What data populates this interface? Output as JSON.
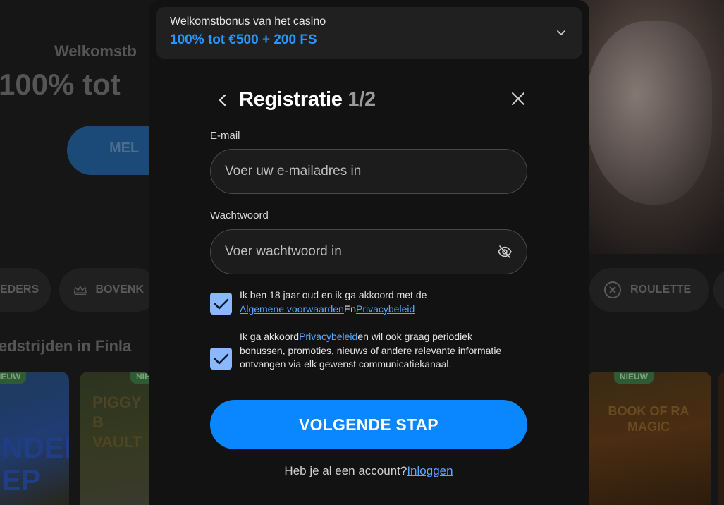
{
  "background": {
    "welcome_text": "Welkomstb",
    "headline": "100% tot",
    "cta_label": "MEL",
    "categories": [
      {
        "label": "EDERS"
      },
      {
        "label": "BOVENK"
      },
      {
        "label": "ROULETTE"
      }
    ],
    "section_title": "edstrijden in Finla",
    "card_badges": [
      "IEUW",
      "NIEU",
      "NIEUW"
    ],
    "card_titles": [
      "NDER EP",
      "PIGGY B VAULT",
      "BOOK OF RA MAGIC"
    ]
  },
  "bonus": {
    "label": "Welkomstbonus van het casino",
    "value": "100% tot €500 + 200 FS"
  },
  "modal": {
    "title": "Registratie",
    "step": "1/2",
    "email": {
      "label": "E-mail",
      "placeholder": "Voer uw e-mailadres in",
      "value": ""
    },
    "password": {
      "label": "Wachtwoord",
      "placeholder": "Voer wachtwoord in",
      "value": ""
    },
    "consent_terms": {
      "checked": true,
      "text_before": "Ik ben 18 jaar oud en ik ga akkoord met de",
      "link_terms": "Algemene voorwaarden",
      "joiner": "En",
      "link_privacy": "Privacybeleid"
    },
    "consent_marketing": {
      "checked": true,
      "text_before": "Ik ga akkoord",
      "link_privacy": "Privacybeleid",
      "text_after": "en wil ook graag periodiek bonussen, promoties, nieuws of andere relevante informatie ontvangen via elk gewenst communicatiekanaal."
    },
    "next_button": "VOLGENDE STAP",
    "login_prompt": "Heb je al een account?",
    "login_link": "Inloggen"
  },
  "colors": {
    "accent": "#0a86ff",
    "bonus_text": "#2996ff",
    "checkbox": "#8ab8ff",
    "link": "#5aa8ff",
    "modal_bg": "#121212"
  }
}
